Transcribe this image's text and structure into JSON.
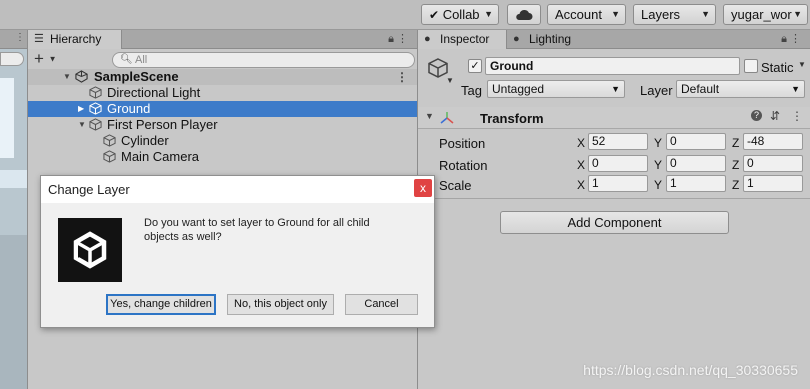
{
  "toolbar": {
    "collab_label": "Collab",
    "account_label": "Account",
    "layers_label": "Layers",
    "layout_label": "yugar_wor"
  },
  "hierarchy": {
    "tab_label": "Hierarchy",
    "add_label": "+",
    "search_placeholder": "All",
    "scene_name": "SampleScene",
    "items": [
      {
        "label": "Directional Light"
      },
      {
        "label": "Ground"
      },
      {
        "label": "First Person Player"
      },
      {
        "label": "Cylinder"
      },
      {
        "label": "Main Camera"
      }
    ]
  },
  "inspector": {
    "tabs": [
      {
        "label": "Inspector"
      },
      {
        "label": "Lighting"
      }
    ],
    "object_name": "Ground",
    "static_label": "Static",
    "tag_label": "Tag",
    "tag_value": "Untagged",
    "layer_label": "Layer",
    "layer_value": "Default",
    "transform": {
      "title": "Transform",
      "rows": [
        {
          "label": "Position",
          "x": "52",
          "y": "0",
          "z": "-48"
        },
        {
          "label": "Rotation",
          "x": "0",
          "y": "0",
          "z": "0"
        },
        {
          "label": "Scale",
          "x": "1",
          "y": "1",
          "z": "1"
        }
      ],
      "axis_x": "X",
      "axis_y": "Y",
      "axis_z": "Z"
    },
    "add_component_label": "Add Component"
  },
  "dialog": {
    "title": "Change Layer",
    "close_glyph": "x",
    "message": "Do you want to set layer to Ground for all child objects as well?",
    "buttons": {
      "yes": "Yes, change children",
      "no": "No, this object only",
      "cancel": "Cancel"
    }
  },
  "watermark": "https://blog.csdn.net/qq_30330655",
  "colors": {
    "selection": "#3d7bc9",
    "close_button": "#e04343"
  },
  "icons": [
    "cloud-icon",
    "lock-icon",
    "menu-dots-icon",
    "search-icon",
    "cube-icon",
    "unity-scene-icon",
    "transform-icon",
    "help-icon",
    "settings-sliders-icon",
    "unity-logo-icon",
    "lighting-icon"
  ]
}
